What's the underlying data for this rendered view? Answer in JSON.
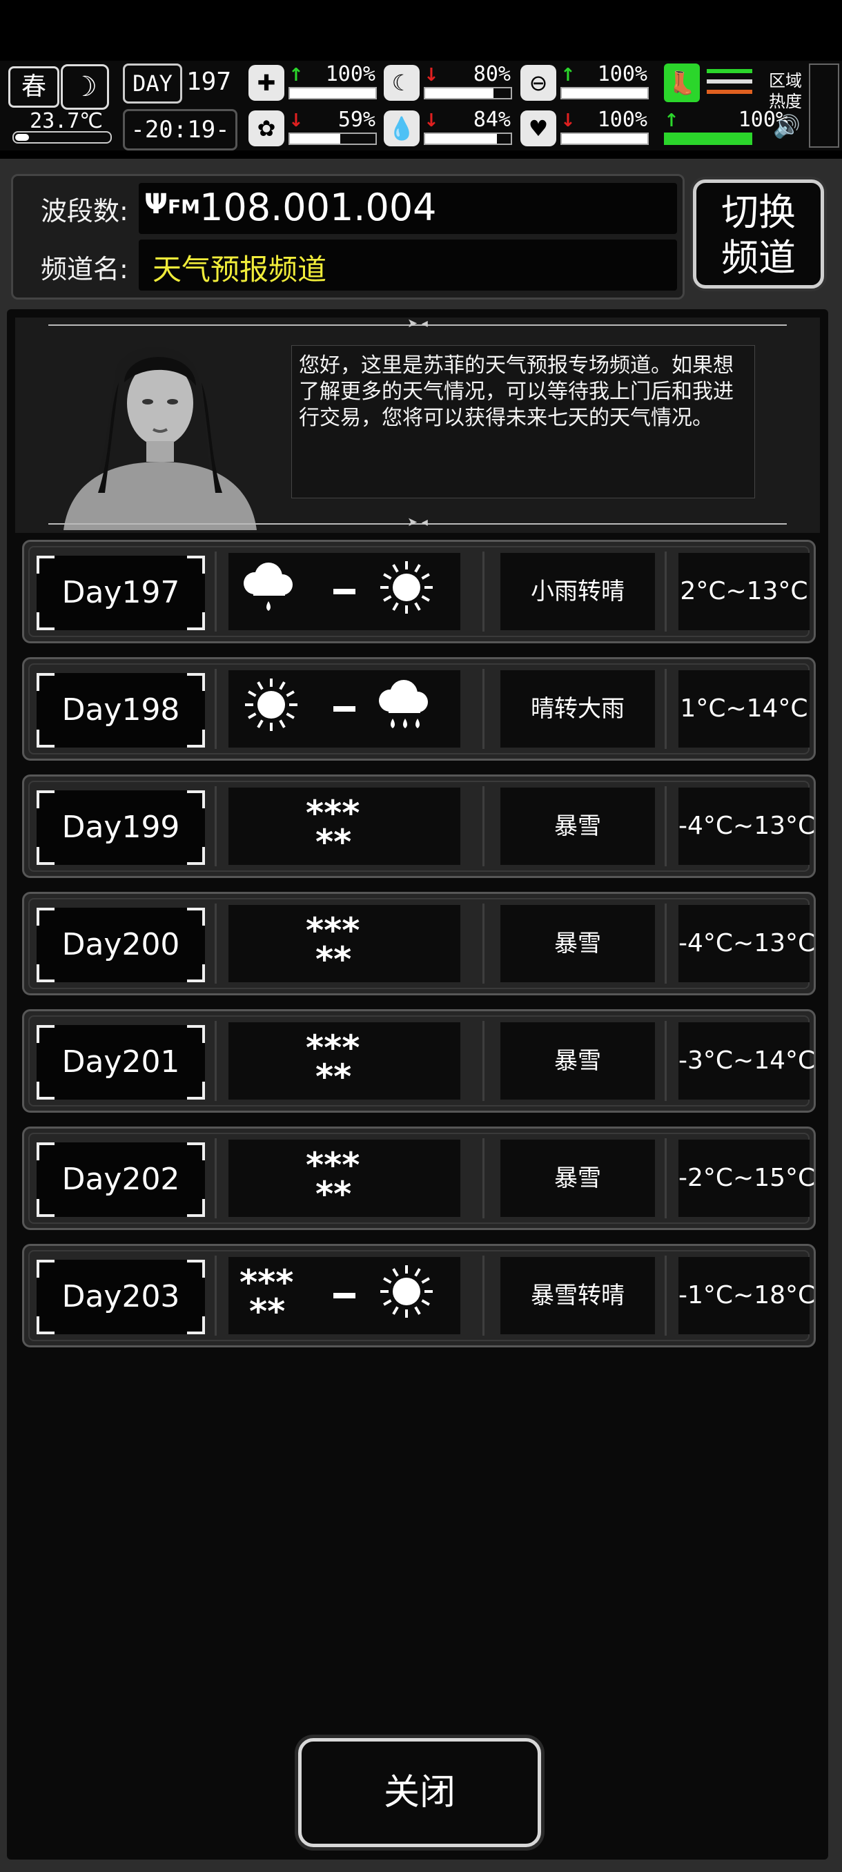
{
  "status": {
    "season": "春",
    "temperature": "23.7℃",
    "day_label": "DAY",
    "day_number": "197",
    "clock": "-20:19-",
    "stats": [
      {
        "icon": "medkit-icon",
        "glyph": "✚",
        "arrow": "up",
        "value": "100%",
        "level": 1.0
      },
      {
        "icon": "stomach-icon",
        "glyph": "☾",
        "arrow": "down",
        "value": "80%",
        "level": 0.8
      },
      {
        "icon": "energy-pill-icon",
        "glyph": "⊖",
        "arrow": "up",
        "value": "100%",
        "level": 1.0
      },
      {
        "icon": "brain-icon",
        "glyph": "✿",
        "arrow": "down",
        "value": "59%",
        "level": 0.59
      },
      {
        "icon": "water-drop-icon",
        "glyph": "💧",
        "arrow": "down",
        "value": "84%",
        "level": 0.84
      },
      {
        "icon": "heart-icon",
        "glyph": "♥",
        "arrow": "down",
        "value": "100%",
        "level": 1.0
      }
    ],
    "speed_value": "100%",
    "speed_level": 1.0,
    "zone_label": "区域\n热度"
  },
  "radio": {
    "band_label": "波段数:",
    "frequency": "108.001.004",
    "fm_icon": "FM",
    "channel_label": "频道名:",
    "channel_name": "天气预报频道",
    "switch_button": "切换\n频道"
  },
  "announcer": {
    "message": "您好，这里是苏菲的天气预报专场频道。如果想了解更多的天气情况，可以等待我上门后和我进行交易，您将可以获得未来七天的天气情况。"
  },
  "forecast": [
    {
      "day": "Day197",
      "icons": [
        "rain",
        "sun"
      ],
      "condition": "小雨转晴",
      "temp": "2°C~13°C"
    },
    {
      "day": "Day198",
      "icons": [
        "sun",
        "heavy-rain"
      ],
      "condition": "晴转大雨",
      "temp": "1°C~14°C"
    },
    {
      "day": "Day199",
      "icons": [
        "snow"
      ],
      "condition": "暴雪",
      "temp": "-4°C~13°C"
    },
    {
      "day": "Day200",
      "icons": [
        "snow"
      ],
      "condition": "暴雪",
      "temp": "-4°C~13°C"
    },
    {
      "day": "Day201",
      "icons": [
        "snow"
      ],
      "condition": "暴雪",
      "temp": "-3°C~14°C"
    },
    {
      "day": "Day202",
      "icons": [
        "snow"
      ],
      "condition": "暴雪",
      "temp": "-2°C~15°C"
    },
    {
      "day": "Day203",
      "icons": [
        "snow",
        "sun"
      ],
      "condition": "暴雪转晴",
      "temp": "-1°C~18°C"
    }
  ],
  "close_button": "关闭",
  "colors": {
    "up": "#2bd62b",
    "down": "#e02020",
    "channel": "#f0ec3a"
  }
}
